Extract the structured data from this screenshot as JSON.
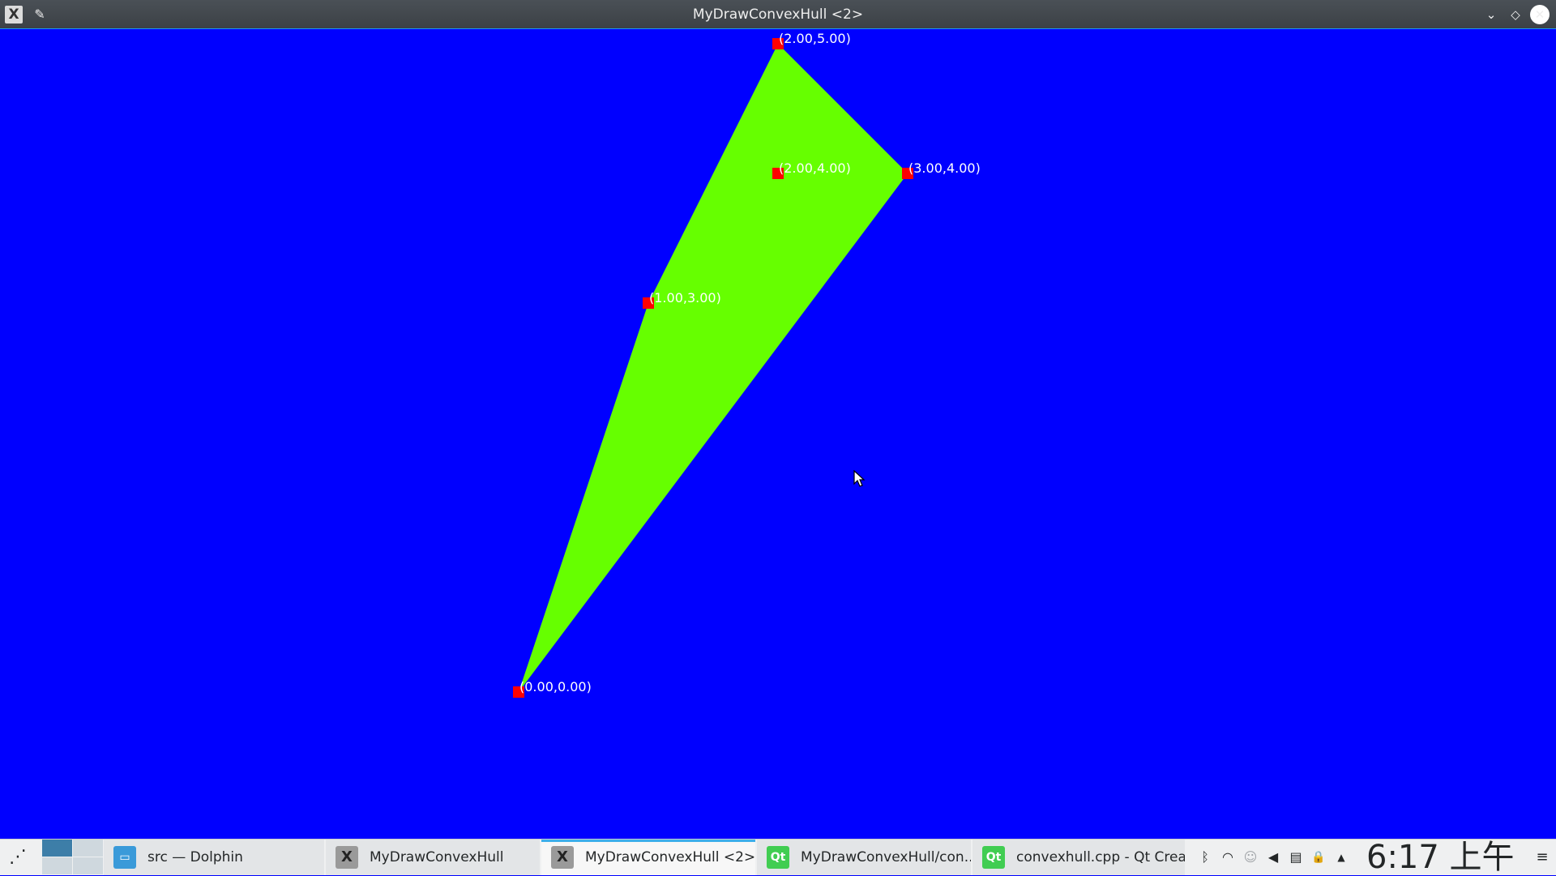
{
  "window": {
    "title": "MyDrawConvexHull <2>",
    "app_icon": "X",
    "pin_icon": "✎",
    "minimize_icon": "⌄",
    "maximize_icon": "◇",
    "close_icon": "✕"
  },
  "canvas": {
    "background": "#0000ff",
    "hull_color": "#66ff00",
    "point_color": "#ff0000",
    "label_color": "#ffffff",
    "points": [
      {
        "x": 0,
        "y": 0,
        "label": "(0.00,0.00)"
      },
      {
        "x": 1,
        "y": 3,
        "label": "(1.00,3.00)"
      },
      {
        "x": 2,
        "y": 4,
        "label": "(2.00,4.00)"
      },
      {
        "x": 2,
        "y": 5,
        "label": "(2.00,5.00)"
      },
      {
        "x": 3,
        "y": 4,
        "label": "(3.00,4.00)"
      }
    ],
    "hull": [
      [
        0,
        0
      ],
      [
        1,
        3
      ],
      [
        2,
        5
      ],
      [
        3,
        4
      ]
    ]
  },
  "taskbar": {
    "launcher_icon": "⋰",
    "tasks": [
      {
        "label": "src — Dolphin",
        "icon": "folder",
        "active": false
      },
      {
        "label": "MyDrawConvexHull",
        "icon": "x11",
        "active": false
      },
      {
        "label": "MyDrawConvexHull <2>",
        "icon": "x11",
        "active": true
      },
      {
        "label": "MyDrawConvexHull/con...",
        "icon": "qt",
        "active": false
      },
      {
        "label": "convexhull.cpp - Qt Crea...",
        "icon": "qt",
        "active": false
      }
    ],
    "icon_glyphs": {
      "folder": "▭",
      "x11": "X",
      "qt": "Qt"
    },
    "tray": {
      "bluetooth": "ᛒ",
      "wifi": "◠",
      "user": "☺",
      "volume": "◀",
      "clipboard": "▤",
      "lock": "🔒",
      "expand": "▲"
    },
    "clock": "6:17 上午",
    "menu_icon": "≡"
  }
}
